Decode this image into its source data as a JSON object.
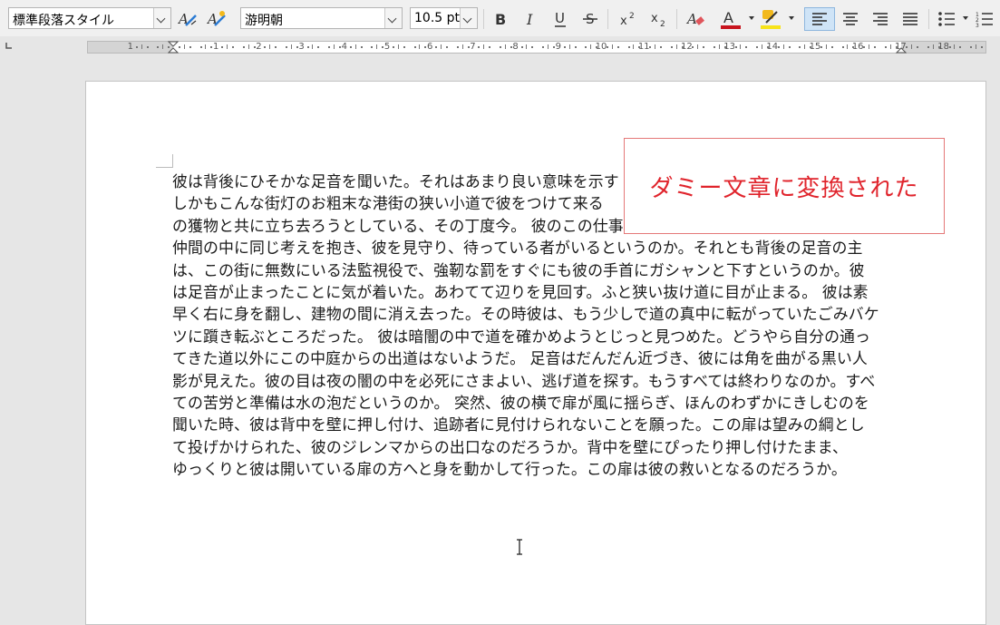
{
  "toolbar": {
    "paragraph_style": "標準段落スタイル",
    "font_name": "游明朝",
    "font_size": "10.5 pt",
    "font_color": "#c8141e",
    "highlight_color": "#f7e31a",
    "icons": [
      "update-style-icon",
      "new-style-icon",
      "bold-icon",
      "italic-icon",
      "underline-icon",
      "strikethrough-icon",
      "superscript-icon",
      "subscript-icon",
      "clear-formatting-icon",
      "font-color-icon",
      "highlight-icon",
      "align-left-icon",
      "align-center-icon",
      "align-right-icon",
      "justify-icon",
      "bullet-list-icon",
      "numbered-list-icon"
    ],
    "active_alignment": "align-left"
  },
  "ruler": {
    "labels": [
      "1",
      "1",
      "2",
      "3",
      "4",
      "5",
      "6",
      "7",
      "8",
      "9",
      "10",
      "11",
      "12",
      "13",
      "14",
      "15",
      "16",
      "17",
      "18"
    ]
  },
  "document": {
    "lines": [
      "彼は背後にひそかな足音を聞いた。それはあまり良い意味を示す",
      "しかもこんな街灯のお粗末な港街の狭い小道で彼をつけて来る",
      "の獲物と共に立ち去ろうとしている、その丁度今。 彼のこの仕事への恐れを和らげるために、数多い",
      "仲間の中に同じ考えを抱き、彼を見守り、待っている者がいるというのか。それとも背後の足音の主",
      "は、この街に無数にいる法監視役で、強靭な罰をすぐにも彼の手首にガシャンと下すというのか。彼",
      "は足音が止まったことに気が着いた。あわてて辺りを見回す。ふと狭い抜け道に目が止まる。 彼は素",
      "早く右に身を翻し、建物の間に消え去った。その時彼は、もう少しで道の真中に転がっていたごみバケ",
      "ツに躓き転ぶところだった。 彼は暗闇の中で道を確かめようとじっと見つめた。どうやら自分の通っ",
      "てきた道以外にこの中庭からの出道はないようだ。 足音はだんだん近づき、彼には角を曲がる黒い人",
      "影が見えた。彼の目は夜の闇の中を必死にさまよい、逃げ道を探す。もうすべては終わりなのか。すべ",
      "ての苦労と準備は水の泡だというのか。 突然、彼の横で扉が風に揺らぎ、ほんのわずかにきしむのを",
      "聞いた時、彼は背中を壁に押し付け、追跡者に見付けられないことを願った。この扉は望みの綱とし",
      "て投げかけられた、彼のジレンマからの出口なのだろうか。背中を壁にぴったり押し付けたまま、",
      "ゆっくりと彼は開いている扉の方へと身を動かして行った。この扉は彼の救いとなるのだろうか。"
    ]
  },
  "callout": {
    "text": "ダミー文章に変換された",
    "color": "#e0242c"
  }
}
